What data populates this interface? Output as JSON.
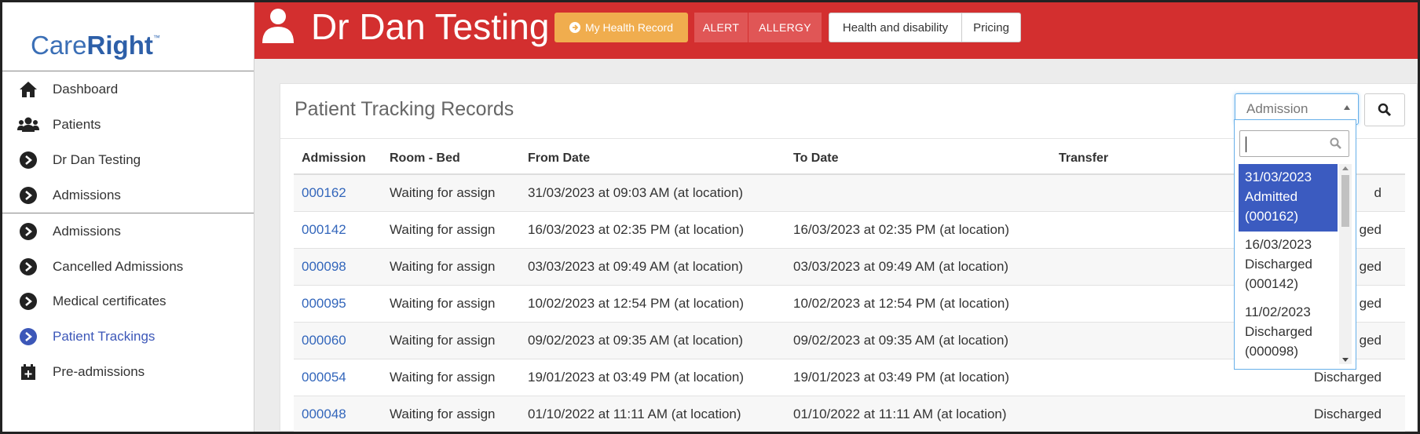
{
  "logo": {
    "part1": "Care",
    "part2": "Right",
    "tm": "™"
  },
  "sidebar": {
    "items": [
      {
        "label": "Dashboard",
        "icon": "home-icon"
      },
      {
        "label": "Patients",
        "icon": "users-icon"
      },
      {
        "label": "Dr Dan Testing",
        "icon": "chevron-circle-icon"
      },
      {
        "label": "Admissions",
        "icon": "chevron-circle-icon"
      },
      {
        "label": "Admissions",
        "icon": "chevron-circle-icon"
      },
      {
        "label": "Cancelled Admissions",
        "icon": "chevron-circle-icon"
      },
      {
        "label": "Medical certificates",
        "icon": "chevron-circle-icon"
      },
      {
        "label": "Patient Trackings",
        "icon": "chevron-circle-icon",
        "active": true
      },
      {
        "label": "Pre-admissions",
        "icon": "calendar-plus-icon"
      }
    ]
  },
  "header": {
    "patient_name": "Dr Dan Testing",
    "buttons": {
      "health_record": "My Health Record",
      "alert": "ALERT",
      "allergy": "ALLERGY",
      "health_disability": "Health and disability",
      "pricing": "Pricing"
    }
  },
  "panel": {
    "title": "Patient Tracking Records",
    "select_value": "Admission"
  },
  "table": {
    "headers": [
      "Admission",
      "Room - Bed",
      "From Date",
      "To Date",
      "Transfer",
      ""
    ],
    "rows": [
      {
        "admission": "000162",
        "room": "Waiting for assign",
        "from": "31/03/2023 at 09:03 AM (at location)",
        "to": "",
        "status": "d"
      },
      {
        "admission": "000142",
        "room": "Waiting for assign",
        "from": "16/03/2023 at 02:35 PM (at location)",
        "to": "16/03/2023 at 02:35 PM (at location)",
        "status": "ged"
      },
      {
        "admission": "000098",
        "room": "Waiting for assign",
        "from": "03/03/2023 at 09:49 AM (at location)",
        "to": "03/03/2023 at 09:49 AM (at location)",
        "status": "ged"
      },
      {
        "admission": "000095",
        "room": "Waiting for assign",
        "from": "10/02/2023 at 12:54 PM (at location)",
        "to": "10/02/2023 at 12:54 PM (at location)",
        "status": "ged"
      },
      {
        "admission": "000060",
        "room": "Waiting for assign",
        "from": "09/02/2023 at 09:35 AM (at location)",
        "to": "09/02/2023 at 09:35 AM (at location)",
        "status": "ged"
      },
      {
        "admission": "000054",
        "room": "Waiting for assign",
        "from": "19/01/2023 at 03:49 PM (at location)",
        "to": "19/01/2023 at 03:49 PM (at location)",
        "status": "Discharged"
      },
      {
        "admission": "000048",
        "room": "Waiting for assign",
        "from": "01/10/2022 at 11:11 AM (at location)",
        "to": "01/10/2022 at 11:11 AM (at location)",
        "status": "Discharged"
      }
    ]
  },
  "dropdown": {
    "options": [
      {
        "date": "31/03/2023",
        "state": "Admitted",
        "code": "(000162)",
        "highlighted": true
      },
      {
        "date": "16/03/2023",
        "state": "Discharged",
        "code": "(000142)"
      },
      {
        "date": "11/02/2023",
        "state": "Discharged",
        "code": "(000098)"
      }
    ]
  },
  "colors": {
    "header_red": "#d32f2f",
    "health_orange": "#f0ad4e",
    "alert_red": "#e05656",
    "active_blue": "#3c57b8",
    "link_blue": "#3366bb",
    "highlight_blue": "#3b5bc0"
  }
}
